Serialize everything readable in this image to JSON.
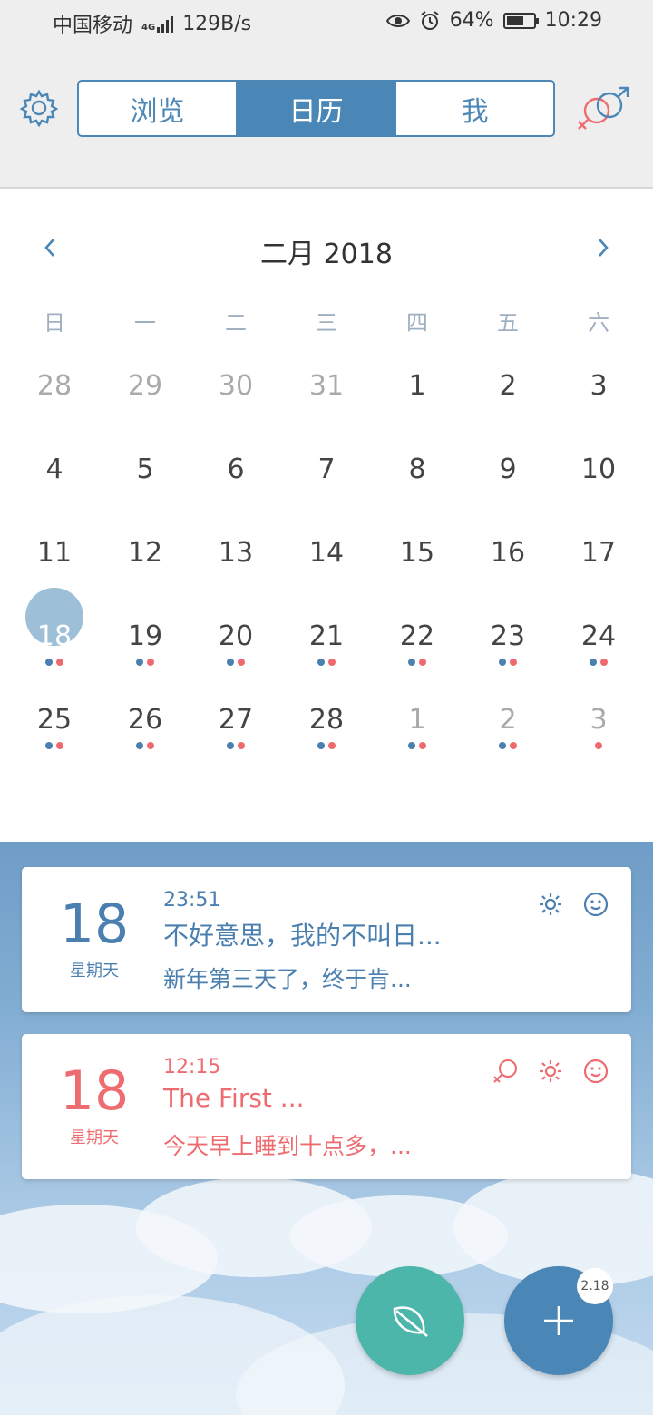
{
  "status_bar": {
    "carrier": "中国移动",
    "network": "4G",
    "speed": "129B/s",
    "battery": "64%",
    "battery_level": 0.64,
    "time": "10:29"
  },
  "header": {
    "tabs": [
      {
        "label": "浏览",
        "active": false
      },
      {
        "label": "日历",
        "active": true
      },
      {
        "label": "我",
        "active": false
      }
    ],
    "accent_color": "#4a86b6"
  },
  "calendar": {
    "title": "二月 2018",
    "weekdays": [
      "日",
      "一",
      "二",
      "三",
      "四",
      "五",
      "六"
    ],
    "days": [
      {
        "n": "28",
        "other": true,
        "dots": ""
      },
      {
        "n": "29",
        "other": true,
        "dots": ""
      },
      {
        "n": "30",
        "other": true,
        "dots": ""
      },
      {
        "n": "31",
        "other": true,
        "dots": ""
      },
      {
        "n": "1",
        "other": false,
        "dots": ""
      },
      {
        "n": "2",
        "other": false,
        "dots": ""
      },
      {
        "n": "3",
        "other": false,
        "dots": ""
      },
      {
        "n": "4",
        "other": false,
        "dots": ""
      },
      {
        "n": "5",
        "other": false,
        "dots": ""
      },
      {
        "n": "6",
        "other": false,
        "dots": ""
      },
      {
        "n": "7",
        "other": false,
        "dots": ""
      },
      {
        "n": "8",
        "other": false,
        "dots": ""
      },
      {
        "n": "9",
        "other": false,
        "dots": ""
      },
      {
        "n": "10",
        "other": false,
        "dots": ""
      },
      {
        "n": "11",
        "other": false,
        "dots": ""
      },
      {
        "n": "12",
        "other": false,
        "dots": ""
      },
      {
        "n": "13",
        "other": false,
        "dots": ""
      },
      {
        "n": "14",
        "other": false,
        "dots": ""
      },
      {
        "n": "15",
        "other": false,
        "dots": ""
      },
      {
        "n": "16",
        "other": false,
        "dots": ""
      },
      {
        "n": "17",
        "other": false,
        "dots": ""
      },
      {
        "n": "18",
        "other": false,
        "dots": "br",
        "selected": true
      },
      {
        "n": "19",
        "other": false,
        "dots": "br"
      },
      {
        "n": "20",
        "other": false,
        "dots": "br"
      },
      {
        "n": "21",
        "other": false,
        "dots": "br"
      },
      {
        "n": "22",
        "other": false,
        "dots": "br"
      },
      {
        "n": "23",
        "other": false,
        "dots": "br"
      },
      {
        "n": "24",
        "other": false,
        "dots": "br"
      },
      {
        "n": "25",
        "other": false,
        "dots": "br"
      },
      {
        "n": "26",
        "other": false,
        "dots": "br"
      },
      {
        "n": "27",
        "other": false,
        "dots": "br"
      },
      {
        "n": "28",
        "other": false,
        "dots": "br"
      },
      {
        "n": "1",
        "other": true,
        "dots": "br"
      },
      {
        "n": "2",
        "other": true,
        "dots": "br"
      },
      {
        "n": "3",
        "other": true,
        "dots": "r"
      }
    ]
  },
  "entries": [
    {
      "day": "18",
      "weekday": "星期天",
      "time": "23:51",
      "title": "不好意思，我的不叫日...",
      "snippet": "新年第三天了，终于肯...",
      "color": "#4a7fb0",
      "icons": [
        "sun-icon",
        "smile-icon"
      ]
    },
    {
      "day": "18",
      "weekday": "星期天",
      "time": "12:15",
      "title": "The First ...",
      "snippet": "今天早上睡到十点多，...",
      "color": "#ee6b6f",
      "icons": [
        "female-icon",
        "sun-icon",
        "smile-icon"
      ]
    }
  ],
  "fab": {
    "badge": "2.18"
  }
}
